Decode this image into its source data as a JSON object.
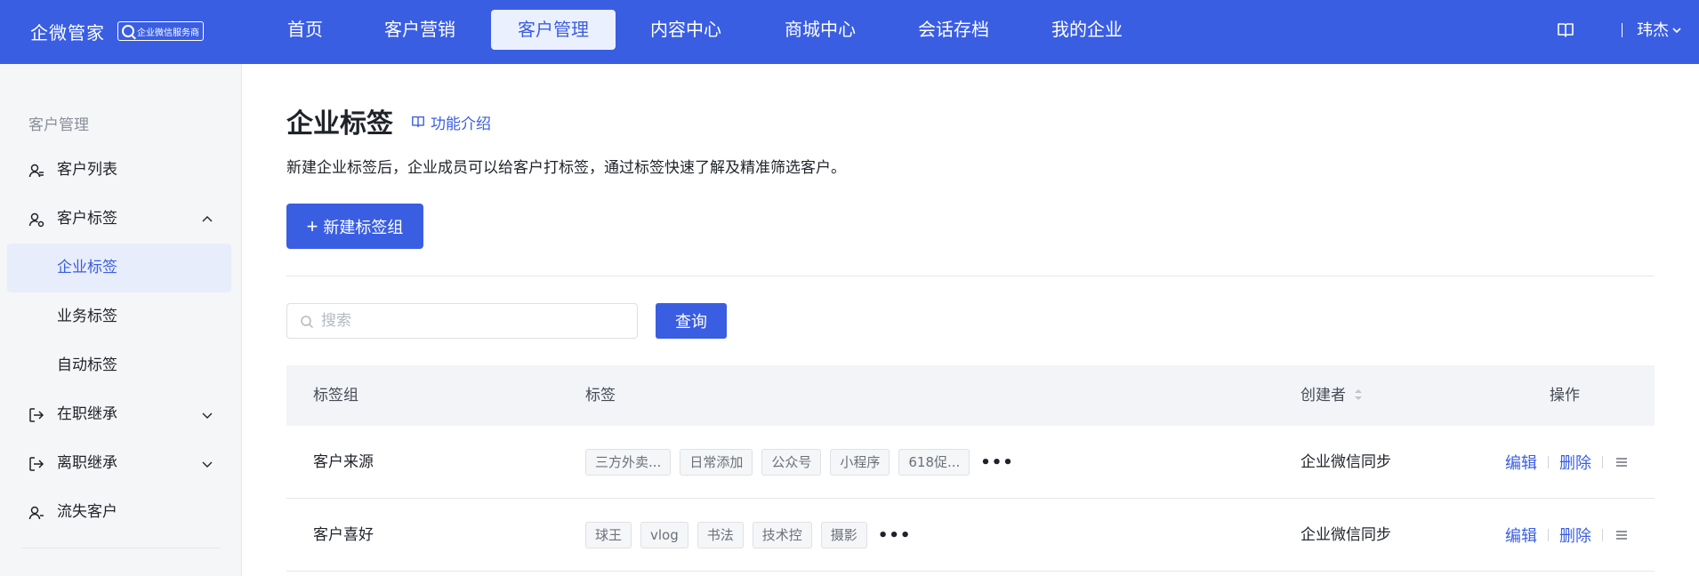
{
  "app": {
    "brand_name": "企微管家",
    "brand_badge": "企业微信服务商"
  },
  "nav": {
    "items": [
      {
        "label": "首页",
        "active": false
      },
      {
        "label": "客户营销",
        "active": false
      },
      {
        "label": "客户管理",
        "active": true
      },
      {
        "label": "内容中心",
        "active": false
      },
      {
        "label": "商城中心",
        "active": false
      },
      {
        "label": "会话存档",
        "active": false
      },
      {
        "label": "我的企业",
        "active": false
      }
    ],
    "user_name": "玮杰"
  },
  "sidebar": {
    "section_title": "客户管理",
    "items": [
      {
        "label": "客户列表",
        "icon": "user-list-icon"
      },
      {
        "label": "客户标签",
        "icon": "user-tag-icon",
        "expanded": true
      },
      {
        "label": "企业标签",
        "sub": true,
        "active": true
      },
      {
        "label": "业务标签",
        "sub": true
      },
      {
        "label": "自动标签",
        "sub": true
      },
      {
        "label": "在职继承",
        "icon": "transfer-in-icon",
        "expanded": false
      },
      {
        "label": "离职继承",
        "icon": "transfer-out-icon",
        "expanded": false
      },
      {
        "label": "流失客户",
        "icon": "lost-user-icon"
      }
    ]
  },
  "main": {
    "title": "企业标签",
    "intro_link": "功能介绍",
    "description": "新建企业标签后，企业成员可以给客户打标签，通过标签快速了解及精准筛选客户。",
    "new_button": "新建标签组",
    "search_placeholder": "搜索",
    "query_button": "查询"
  },
  "table": {
    "columns": [
      "标签组",
      "标签",
      "创建者",
      "操作"
    ],
    "rows": [
      {
        "group": "客户来源",
        "tags": [
          "三方外卖...",
          "日常添加",
          "公众号",
          "小程序",
          "618促..."
        ],
        "creator": "企业微信同步",
        "edit": "编辑",
        "delete": "删除"
      },
      {
        "group": "客户喜好",
        "tags": [
          "球王",
          "vlog",
          "书法",
          "技术控",
          "摄影"
        ],
        "creator": "企业微信同步",
        "edit": "编辑",
        "delete": "删除"
      }
    ]
  },
  "colors": {
    "primary": "#3a5ee2",
    "nav_active_bg": "#ebf0ff",
    "sidebar_bg": "#f5f6f8",
    "table_header_bg": "#f2f4f7"
  }
}
